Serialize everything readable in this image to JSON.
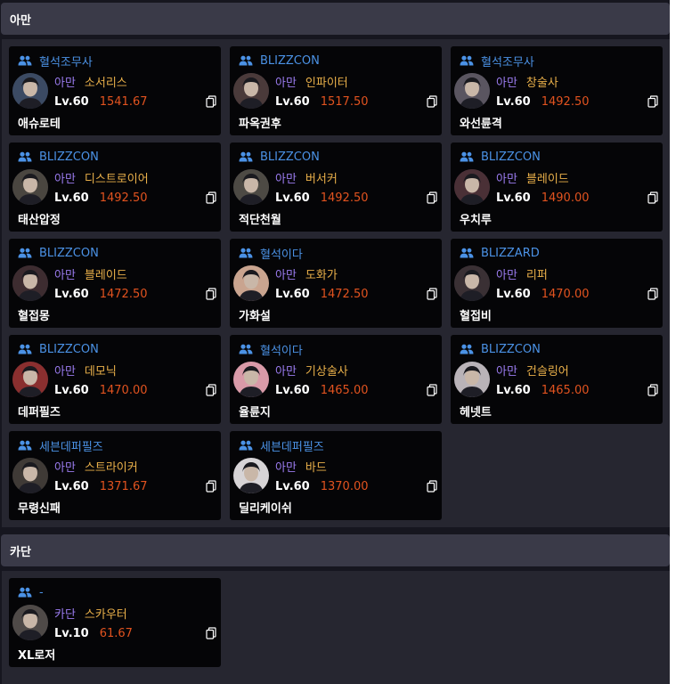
{
  "sections": [
    {
      "title": "아만",
      "characters": [
        {
          "guild": "혈석조무사",
          "server": "아만",
          "class": "소서리스",
          "level": "Lv.60",
          "item_level": "1541.67",
          "name": "애슈로테",
          "portrait": "sorceress-portrait-icon",
          "tint": "#3b4a63"
        },
        {
          "guild": "BLIZZCON",
          "server": "아만",
          "class": "인파이터",
          "level": "Lv.60",
          "item_level": "1517.50",
          "name": "파옥권후",
          "portrait": "infighter-portrait-icon",
          "tint": "#4a3a3a"
        },
        {
          "guild": "혈석조무사",
          "server": "아만",
          "class": "창술사",
          "level": "Lv.60",
          "item_level": "1492.50",
          "name": "와선륜격",
          "portrait": "lancemaster-portrait-icon",
          "tint": "#5a5560"
        },
        {
          "guild": "BLIZZCON",
          "server": "아만",
          "class": "디스트로이어",
          "level": "Lv.60",
          "item_level": "1492.50",
          "name": "태산압정",
          "portrait": "destroyer-portrait-icon",
          "tint": "#4a4640"
        },
        {
          "guild": "BLIZZCON",
          "server": "아만",
          "class": "버서커",
          "level": "Lv.60",
          "item_level": "1492.50",
          "name": "적단천월",
          "portrait": "berserker-portrait-icon",
          "tint": "#4d4a44"
        },
        {
          "guild": "BLIZZCON",
          "server": "아만",
          "class": "블레이드",
          "level": "Lv.60",
          "item_level": "1490.00",
          "name": "우치루",
          "portrait": "blade-portrait-icon",
          "tint": "#4a3036"
        },
        {
          "guild": "BLIZZCON",
          "server": "아만",
          "class": "블레이드",
          "level": "Lv.60",
          "item_level": "1472.50",
          "name": "혈접몽",
          "portrait": "blade-portrait-icon",
          "tint": "#3d2c30"
        },
        {
          "guild": "혈석이다",
          "server": "아만",
          "class": "도화가",
          "level": "Lv.60",
          "item_level": "1472.50",
          "name": "가화설",
          "portrait": "artist-portrait-icon",
          "tint": "#c9a48f"
        },
        {
          "guild": "BLIZZARD",
          "server": "아만",
          "class": "리퍼",
          "level": "Lv.60",
          "item_level": "1470.00",
          "name": "혈접비",
          "portrait": "reaper-portrait-icon",
          "tint": "#3a3034"
        },
        {
          "guild": "BLIZZCON",
          "server": "아만",
          "class": "데모닉",
          "level": "Lv.60",
          "item_level": "1470.00",
          "name": "데퍼필즈",
          "portrait": "demonic-portrait-icon",
          "tint": "#8a2f2f"
        },
        {
          "guild": "혈석이다",
          "server": "아만",
          "class": "기상술사",
          "level": "Lv.60",
          "item_level": "1465.00",
          "name": "율륜지",
          "portrait": "aeromancer-portrait-icon",
          "tint": "#d99aa8"
        },
        {
          "guild": "BLIZZCON",
          "server": "아만",
          "class": "건슬링어",
          "level": "Lv.60",
          "item_level": "1465.00",
          "name": "헤넷트",
          "portrait": "gunslinger-portrait-icon",
          "tint": "#b9b3b8"
        },
        {
          "guild": "세븐데퍼필즈",
          "server": "아만",
          "class": "스트라이커",
          "level": "Lv.60",
          "item_level": "1371.67",
          "name": "무령신패",
          "portrait": "striker-portrait-icon",
          "tint": "#3f3a36"
        },
        {
          "guild": "세븐데퍼필즈",
          "server": "아만",
          "class": "바드",
          "level": "Lv.60",
          "item_level": "1370.00",
          "name": "딜리케이쉬",
          "portrait": "bard-portrait-icon",
          "tint": "#d7d4d6"
        }
      ]
    },
    {
      "title": "카단",
      "characters": [
        {
          "guild": "-",
          "server": "카단",
          "class": "스카우터",
          "level": "Lv.10",
          "item_level": "61.67",
          "name": "XL로저",
          "portrait": "scouter-portrait-icon",
          "tint": "#4f4a48"
        }
      ]
    }
  ]
}
